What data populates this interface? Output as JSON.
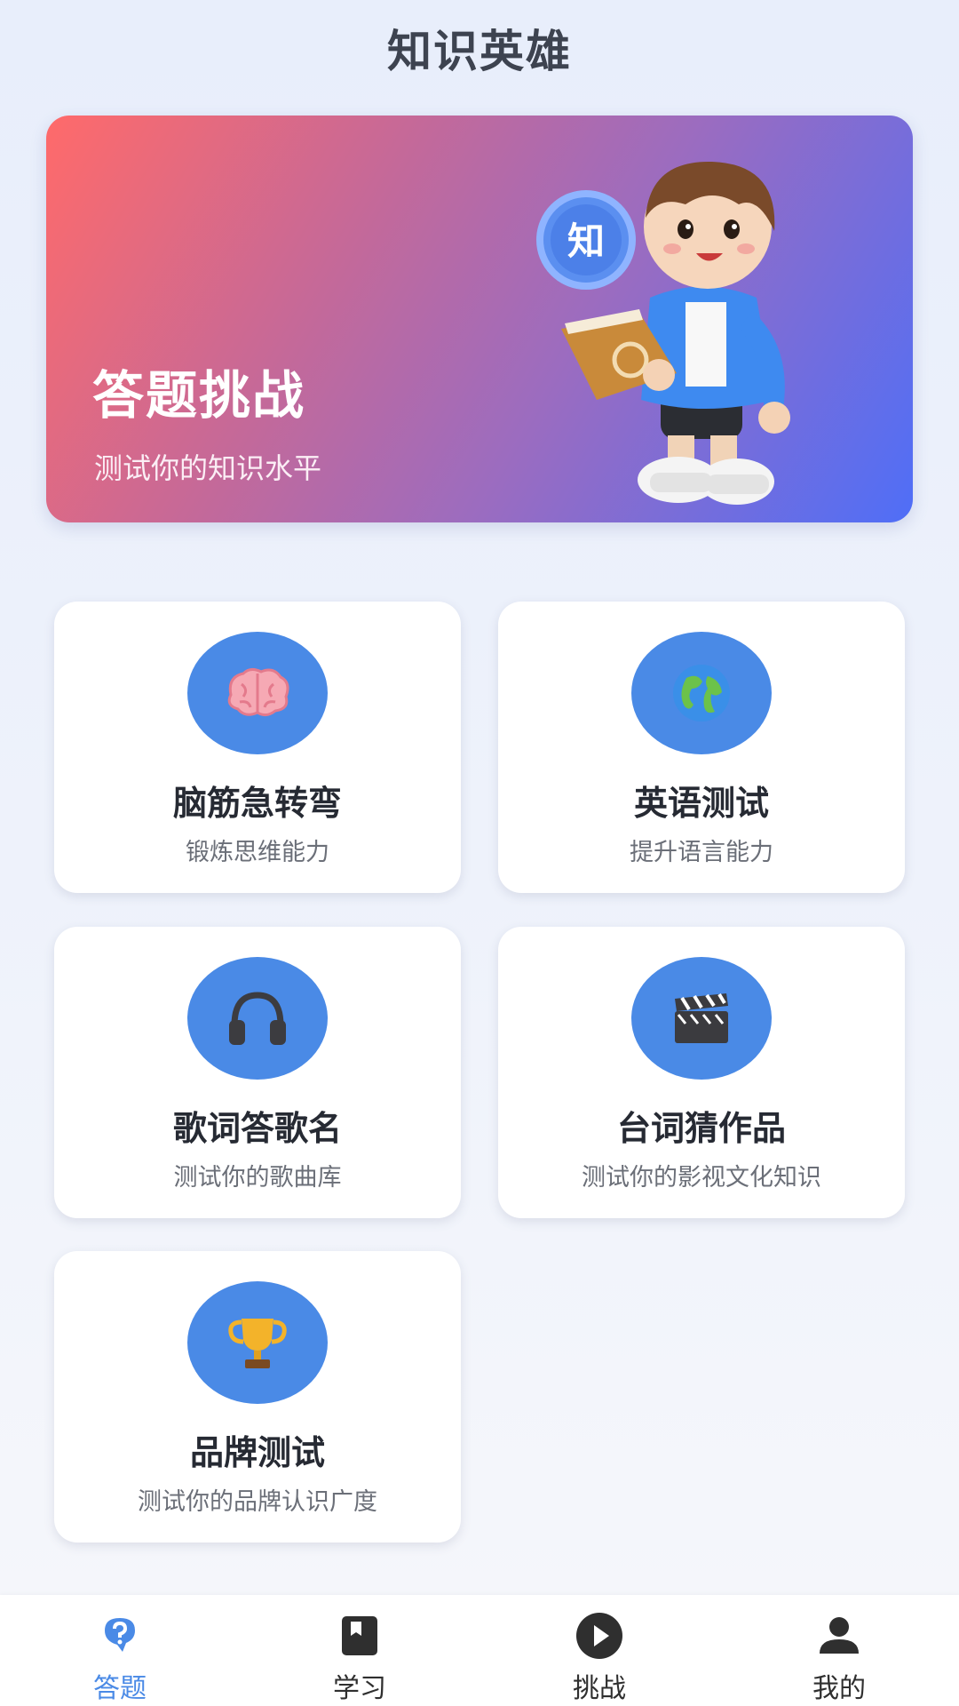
{
  "header": {
    "title": "知识英雄"
  },
  "hero": {
    "title": "答题挑战",
    "subtitle": "测试你的知识水平",
    "badge_char": "知"
  },
  "categories": [
    {
      "icon": "brain-icon",
      "title": "脑筋急转弯",
      "desc": "锻炼思维能力"
    },
    {
      "icon": "globe-icon",
      "title": "英语测试",
      "desc": "提升语言能力"
    },
    {
      "icon": "headphones-icon",
      "title": "歌词答歌名",
      "desc": "测试你的歌曲库"
    },
    {
      "icon": "clapperboard-icon",
      "title": "台词猜作品",
      "desc": "测试你的影视文化知识"
    },
    {
      "icon": "trophy-icon",
      "title": "品牌测试",
      "desc": "测试你的品牌认识广度"
    }
  ],
  "tabs": [
    {
      "label": "答题",
      "icon": "quiz-icon",
      "active": true
    },
    {
      "label": "学习",
      "icon": "book-icon",
      "active": false
    },
    {
      "label": "挑战",
      "icon": "play-icon",
      "active": false
    },
    {
      "label": "我的",
      "icon": "person-icon",
      "active": false
    }
  ],
  "colors": {
    "accent": "#4a8ae6",
    "hero_gradient_start": "#ff6a6a",
    "hero_gradient_end": "#4f6ef7"
  }
}
